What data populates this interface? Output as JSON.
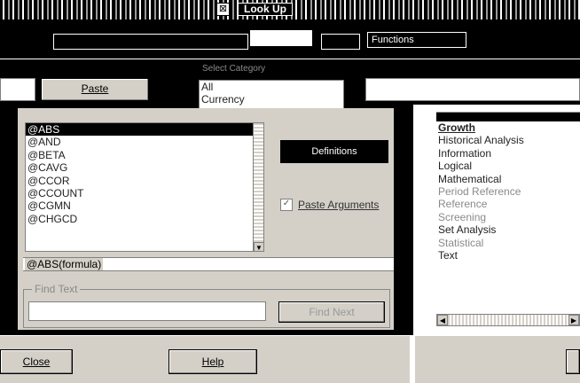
{
  "window": {
    "title": "Look Up",
    "close_glyph": "⊠"
  },
  "tabs": [
    "",
    "",
    "Functions"
  ],
  "toolbar": {
    "paste_label": "Paste"
  },
  "category_box": {
    "label": "Select Category",
    "items": [
      "All",
      "Currency",
      ""
    ]
  },
  "description_label": "",
  "function_list": {
    "items": [
      "@ABS",
      "@AND",
      "@BETA",
      "@CAVG",
      "@CCOR",
      "@CCOUNT",
      "@CGMN",
      "@CHGCD"
    ],
    "selected_index": 0
  },
  "syntax_text": "@ABS(formula)",
  "options": {
    "definitions_label": "Definitions",
    "paste_arguments_label": "Paste Arguments",
    "paste_arguments_checked": true
  },
  "find": {
    "group_label": "Find Text",
    "input_value": "",
    "find_next_label": "Find Next"
  },
  "categories_right": {
    "items": [
      "Growth",
      "Historical Analysis",
      "Information",
      "Logical",
      "Mathematical",
      "Period Reference",
      "Reference",
      "Screening",
      "Set Analysis",
      "Statistical",
      "Text"
    ]
  },
  "footer": {
    "close_label": "Close",
    "help_label": "Help"
  },
  "colors": {
    "chrome": "#d4d0c8",
    "highlight": "#000000",
    "window_bg": "#ffffff"
  }
}
